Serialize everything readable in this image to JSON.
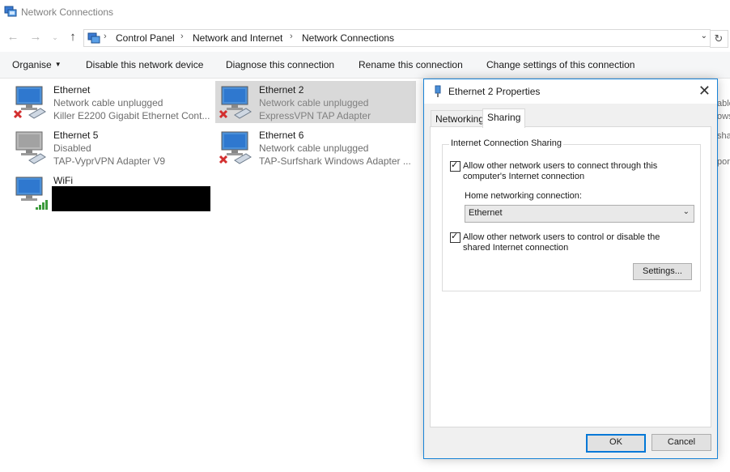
{
  "window": {
    "title": "Network Connections"
  },
  "address": {
    "crumbs": [
      "Control Panel",
      "Network and Internet",
      "Network Connections"
    ]
  },
  "commands": {
    "organise": "Organise",
    "disable": "Disable this network device",
    "diagnose": "Diagnose this connection",
    "rename": "Rename this connection",
    "change": "Change settings of this connection"
  },
  "adapters": [
    {
      "name": "Ethernet",
      "status": "Network cable unplugged",
      "device": "Killer E2200 Gigabit Ethernet Cont...",
      "state": "unplugged"
    },
    {
      "name": "Ethernet 2",
      "status": "Network cable unplugged",
      "device": "ExpressVPN TAP Adapter",
      "state": "unplugged",
      "selected": true
    },
    {
      "name": "Ethernet 5",
      "status": "Disabled",
      "device": "TAP-VyprVPN Adapter V9",
      "state": "disabled"
    },
    {
      "name": "Ethernet 6",
      "status": "Network cable unplugged",
      "device": "TAP-Surfshark Windows Adapter ...",
      "state": "unplugged"
    },
    {
      "name": "WiFi",
      "status": "",
      "device": "",
      "state": "wifi"
    }
  ],
  "clipped_right": [
    "able",
    "ows",
    "sha",
    "por"
  ],
  "dialog": {
    "title": "Ethernet 2 Properties",
    "tabs": [
      "Networking",
      "Sharing"
    ],
    "active_tab": "Sharing",
    "group_title": "Internet Connection Sharing",
    "allow_connect": "Allow other network users to connect through this computer's Internet connection",
    "allow_connect_checked": true,
    "home_label": "Home networking connection:",
    "home_value": "Ethernet",
    "allow_control": "Allow other network users to control or disable the shared Internet connection",
    "allow_control_checked": true,
    "settings_label": "Settings...",
    "ok_label": "OK",
    "cancel_label": "Cancel"
  },
  "colors": {
    "accent": "#0078d7",
    "selection": "#d9d9d9",
    "error": "#d32f2f"
  }
}
